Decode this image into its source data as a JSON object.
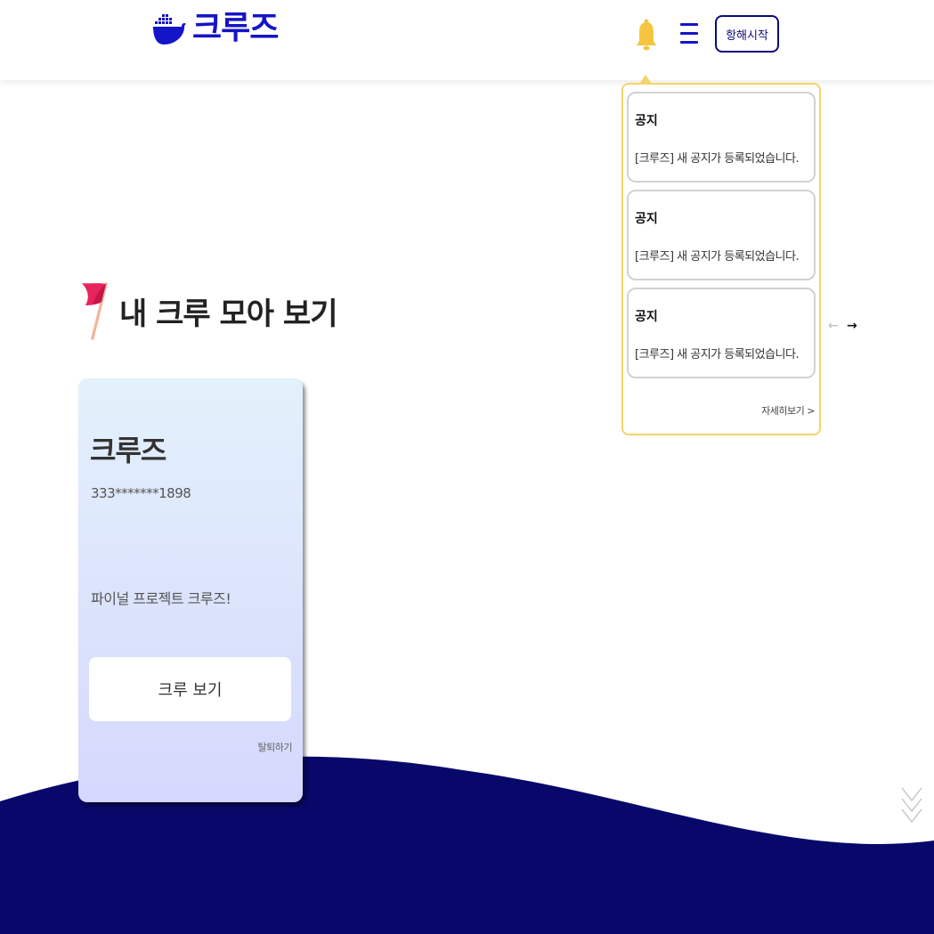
{
  "header": {
    "logo_text": "크루즈",
    "start_button_label": "항해시작"
  },
  "icons": {
    "logo": "whale-ship-icon",
    "bell": "bell-icon",
    "menu": "hamburger-menu-icon",
    "flag": "flag-icon",
    "scroll": "double-chevron-down-icon"
  },
  "notifications": {
    "items": [
      {
        "title": "공지",
        "message": "[크루즈] 새 공지가 등록되었습니다."
      },
      {
        "title": "공지",
        "message": "[크루즈] 새 공지가 등록되었습니다."
      },
      {
        "title": "공지",
        "message": "[크루즈] 새 공지가 등록되었습니다."
      }
    ],
    "more_label": "자세히보기 >",
    "prev_label": "←",
    "next_label": "→"
  },
  "section": {
    "title": "내 크루 모아 보기"
  },
  "crew_card": {
    "name": "크루즈",
    "code": "333*******1898",
    "description": "파이널 프로젝트 크루즈!",
    "view_button_label": "크루 보기",
    "leave_label": "탈퇴하기"
  },
  "colors": {
    "brand": "#1414c8",
    "wave": "#08086b",
    "notif_border": "#f5d36a",
    "bell": "#f5c542"
  }
}
